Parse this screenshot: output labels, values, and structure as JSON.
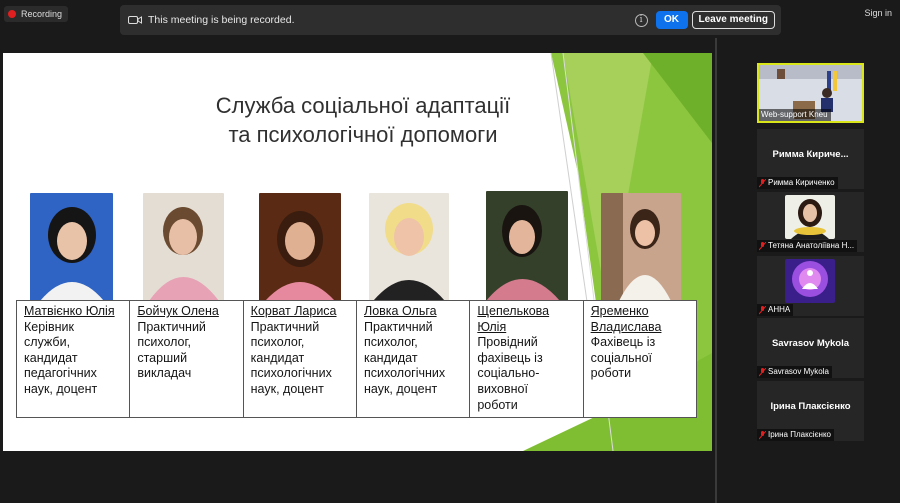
{
  "recording": {
    "label": "Recording"
  },
  "banner": {
    "text": "This meeting is being recorded.",
    "info_glyph": "i",
    "ok_label": "OK",
    "leave_label": "Leave meeting"
  },
  "signin": {
    "label": "Sign in"
  },
  "slide": {
    "title_line1": "Служба соціальної адаптації",
    "title_line2": "та психологічної допомоги",
    "people": [
      {
        "name": "Матвієнко Юлія",
        "role": [
          "Керівник",
          "служби,",
          "кандидат",
          "педагогічних",
          "наук, доцент"
        ]
      },
      {
        "name": "Бойчук Олена",
        "role": [
          "Практичний",
          "психолог,",
          "старший",
          "викладач"
        ]
      },
      {
        "name": "Корват Лариса",
        "role": [
          "Практичний",
          "психолог,",
          "кандидат",
          "психологічних",
          "наук, доцент"
        ]
      },
      {
        "name": "Ловка Ольга",
        "role": [
          "Практичний",
          "психолог,",
          "кандидат",
          "психологічних",
          "наук, доцент"
        ]
      },
      {
        "name_lines": [
          "Щепелькова",
          "Юлія"
        ],
        "role": [
          "Провідний",
          "фахівець із",
          "соціально-",
          "виховної",
          "роботи"
        ]
      },
      {
        "name_lines": [
          "Яременко",
          "Владислава"
        ],
        "role": [
          "Фахівець із",
          "соціальної",
          "роботи"
        ]
      }
    ]
  },
  "participants": [
    {
      "tag": "Web-support Kneu"
    },
    {
      "display": "Римма Кириче...",
      "tag": "Римма Кириченко"
    },
    {
      "tag": "Тетяна Анатоліївна Н..."
    },
    {
      "tag": "АННА"
    },
    {
      "display": "Savrasov Mykola",
      "tag": "Savrasov Mykola"
    },
    {
      "display": "Ірина Плаксієнко",
      "tag": "Ірина Плаксієнко"
    }
  ],
  "colors": {
    "accent_green": "#8cc63f",
    "ok_blue": "#0e72ed",
    "active_border": "#d8e61a",
    "mic_muted": "#e02020"
  }
}
